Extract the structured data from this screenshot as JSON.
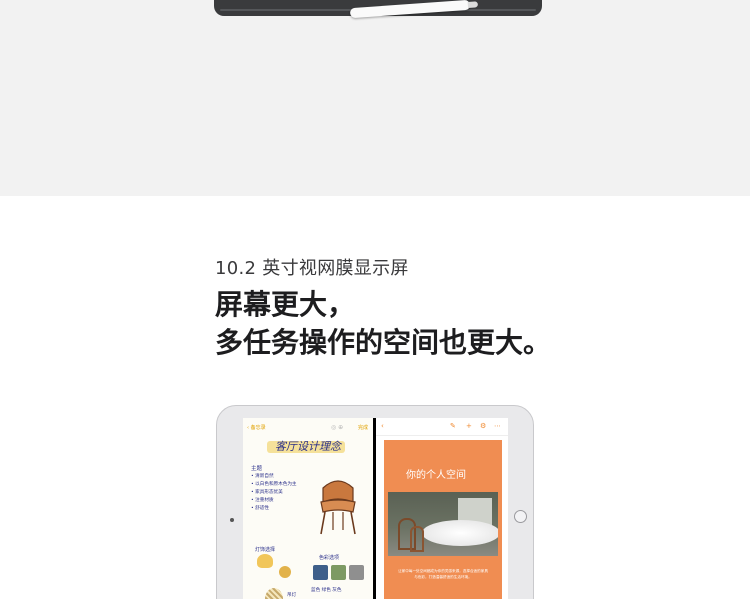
{
  "hero": {
    "subtitle": "10.2 英寸视网膜显示屏",
    "headline_line1": "屏幕更大，",
    "headline_line2": "多任务操作的空间也更大。"
  },
  "notes_app": {
    "back_label": "备忘录",
    "done_label": "完成",
    "title": "客厅设计理念",
    "list_heading": "主题",
    "list_items": [
      "• 清新自然",
      "• 以白色和原木色为主",
      "• 家具形态优美",
      "• 注重材质",
      "• 舒适性"
    ],
    "lamp_label": "灯饰选择",
    "color_label": "色彩选项",
    "swatch_labels": "蓝色 绿色 灰色",
    "lamp_note": "吊灯"
  },
  "pages_app": {
    "heading": "你的个人空间",
    "body_text": "让家中每一处空间都成为你的灵感来源，选择合适的家具与色彩，打造温馨舒适的生活环境。"
  },
  "colors": {
    "top_band": "#f2f2f2",
    "pages_accent": "#f08d52",
    "notes_ink": "#2a2f8a"
  }
}
